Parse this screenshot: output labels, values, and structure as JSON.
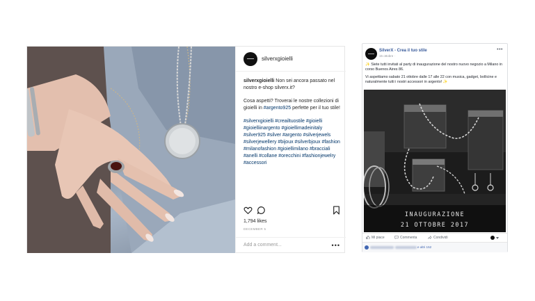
{
  "instagram": {
    "username": "silverxgioielli",
    "caption": {
      "author": "silverxgioielli",
      "intro": " Non sei ancora passato nel nostro e-shop silverx.it?",
      "question_a": "Cosa aspetti? Troverai le nostre collezioni di gioielli in ",
      "question_tag": "#argento925",
      "question_b": " perfette per il tuo stile!",
      "hashtags": "#silverxgioielli #creailtuostile #gioielli #gioielliinargento #gioiellimadeinitaly #silver925 #silver #argento #silverjewels #silverjewellery #bijoux #silverbjoux #fashion #milanofashion #gioiellimilano #bracciali #anelli #collane #orecchini #fashionjewelry #accessori"
    },
    "likes": "1,794 likes",
    "date": "DECEMBER 5",
    "comment_placeholder": "Add a comment...",
    "more_label": "•••",
    "icons": [
      "heart-icon",
      "comment-icon",
      "bookmark-icon"
    ]
  },
  "facebook": {
    "page_name": "SilverX - Crea il tuo stile",
    "time": "15 ottobre ·",
    "menu_label": "•••",
    "text_p1": "Siete tutti invitati al party di inaugurazione del nostro nuovo negozio a Milano in corso Buenos Aires 86.",
    "text_p2": "Vi aspettiamo sabato 21 ottobre dalle 17 alle 22 con musica, gadget, bollicine e naturalmente tutti i nostri accessori in argento!",
    "emoji_glyph": "✨",
    "image_title": "INAUGURAZIONE",
    "image_date": "21 OTTOBRE 2017",
    "actions": {
      "like": "Mi piace",
      "comment": "Commenta",
      "share": "Condividi"
    },
    "reactions_others": "e altri 152",
    "colors": {
      "link": "#365899",
      "accent": "#4267b2"
    }
  }
}
